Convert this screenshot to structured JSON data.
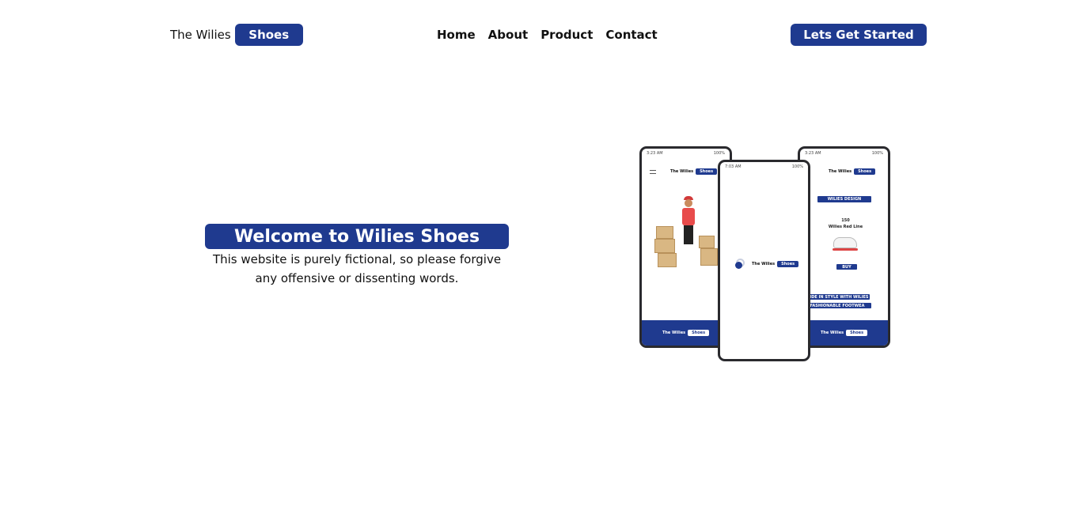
{
  "header": {
    "brand_text": "The Wilies",
    "brand_badge": "Shoes",
    "nav": [
      "Home",
      "About",
      "Product",
      "Contact"
    ],
    "cta_label": "Lets Get Started"
  },
  "hero": {
    "title": "Welcome to Wilies Shoes",
    "subtitle_line1": "This website is purely fictional, so please forgive",
    "subtitle_line2": "any offensive or dissenting words."
  },
  "mockup": {
    "left_status_time": "3:23 AM",
    "right_status": "100%",
    "center_status_time": "7:03 AM",
    "brand_text": "The Wilies",
    "brand_badge": "Shoes",
    "section_title": "WILIES DESIGN",
    "product_price": "150",
    "product_name": "Wilies Red Line",
    "buy_label": "BUY",
    "tagline1": "STRIDE IN STYLE WITH WILIES",
    "tagline2": "FASHIONABLE FOOTWEA"
  },
  "colors": {
    "accent": "#1f3a8f",
    "text": "#111111",
    "background": "#ffffff"
  }
}
